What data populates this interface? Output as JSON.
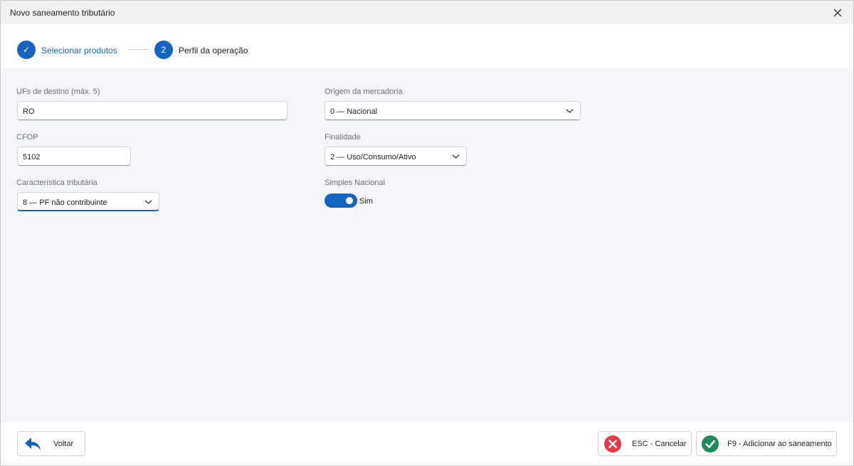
{
  "window": {
    "title": "Novo saneamento tributário"
  },
  "stepper": {
    "steps": [
      {
        "marker": "✓",
        "label": "Selecionar produtos",
        "state": "done"
      },
      {
        "marker": "2",
        "label": "Perfil da operação",
        "state": "current"
      }
    ]
  },
  "form": {
    "ufs": {
      "label": "UFs de destino (máx. 5)",
      "value": "RO"
    },
    "cfop": {
      "label": "CFOP",
      "value": "5102"
    },
    "caracteristica": {
      "label": "Característica tributária",
      "value": "8 — PF não contribuinte"
    },
    "origem": {
      "label": "Origem da mercadoria",
      "value": "0 — Nacional"
    },
    "finalidade": {
      "label": "Finalidade",
      "value": "2 — Uso/Consumo/Ativo"
    },
    "simples": {
      "label": "Simples Nacional",
      "value": "Sim",
      "on": true
    }
  },
  "footer": {
    "back_label": "Voltar",
    "cancel_label": "ESC - Cancelar",
    "confirm_label": "F9 - Adicionar ao saneamento"
  },
  "colors": {
    "accent": "#1565c0",
    "cancel": "#e53945",
    "confirm": "#1e8a5a"
  }
}
